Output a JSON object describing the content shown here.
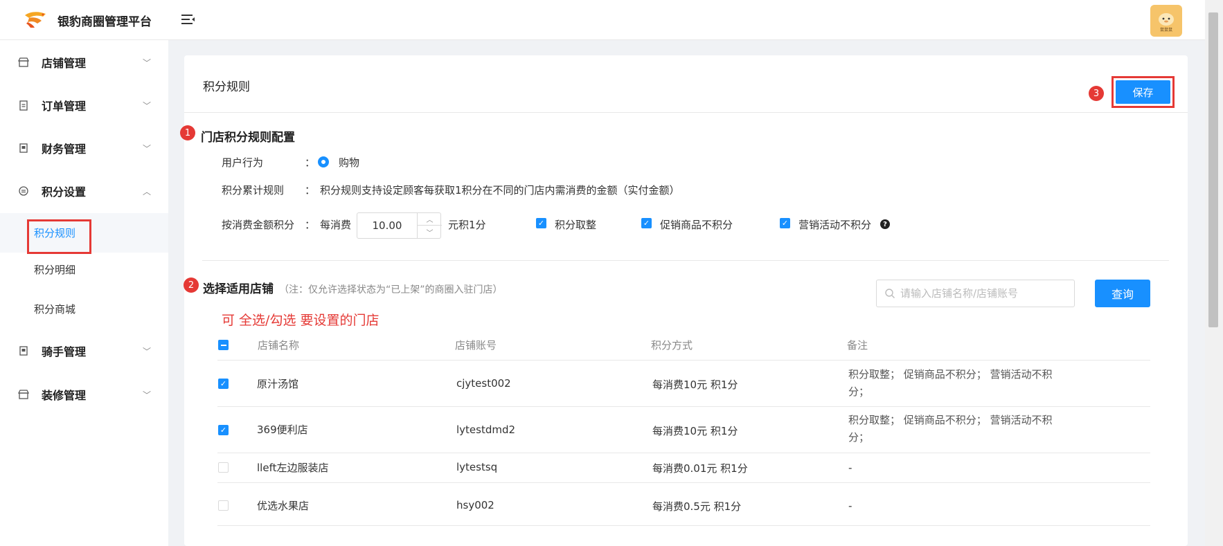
{
  "header": {
    "brand": "银豹商圈管理平台",
    "avatar_text": "鼠鼠鼠"
  },
  "sidebar": {
    "items": [
      {
        "label": "店铺管理",
        "icon": "store-icon"
      },
      {
        "label": "订单管理",
        "icon": "clipboard-icon"
      },
      {
        "label": "财务管理",
        "icon": "ledger-icon"
      },
      {
        "label": "积分设置",
        "icon": "points-icon"
      },
      {
        "label": "骑手管理",
        "icon": "rider-icon"
      },
      {
        "label": "装修管理",
        "icon": "decor-icon"
      }
    ],
    "sub_items": [
      "积分规则",
      "积分明细",
      "积分商城"
    ]
  },
  "page": {
    "title": "积分规则",
    "save_label": "保存"
  },
  "badges": [
    "1",
    "2",
    "3"
  ],
  "section1": {
    "title": "门店积分规则配置",
    "user_action_label": "用户行为",
    "user_action_value": "购物",
    "accumulate_label": "积分累计规则",
    "accumulate_desc": "积分规则支持设定顾客每获取1积分在不同的门店内需消费的金额（实付金额）",
    "amount_label": "按消费金额积分",
    "per_spend_prefix": "每消费",
    "amount_value": "10.00",
    "per_spend_suffix": "元积1分",
    "options": [
      {
        "label": "积分取整",
        "checked": true
      },
      {
        "label": "促销商品不积分",
        "checked": true
      },
      {
        "label": "营销活动不积分",
        "checked": true
      }
    ],
    "colon": "："
  },
  "section2": {
    "title": "选择适用店铺",
    "note": "（注：仅允许选择状态为“已上架”的商圈入驻门店）",
    "search_placeholder": "请输入店铺名称/店铺账号",
    "query_label": "查询",
    "hint": "可 全选/勾选 要设置的门店"
  },
  "table": {
    "columns": [
      "店铺名称",
      "店铺账号",
      "积分方式",
      "备注"
    ],
    "rows": [
      {
        "name": "原汁汤馆",
        "account": "cjytest002",
        "method": "每消费10元 积1分",
        "note": "积分取整； 促销商品不积分； 营销活动不积分；",
        "checked": true
      },
      {
        "name": "369便利店",
        "account": "lytestdmd2",
        "method": "每消费10元 积1分",
        "note": "积分取整； 促销商品不积分； 营销活动不积分；",
        "checked": true
      },
      {
        "name": "lleft左边服装店",
        "account": "lytestsq",
        "method": "每消费0.01元 积1分",
        "note": "-",
        "checked": false
      },
      {
        "name": "优选水果店",
        "account": "hsy002",
        "method": "每消费0.5元 积1分",
        "note": "-",
        "checked": false
      }
    ]
  },
  "colors": {
    "primary": "#1890ff",
    "highlight": "#e53935"
  }
}
